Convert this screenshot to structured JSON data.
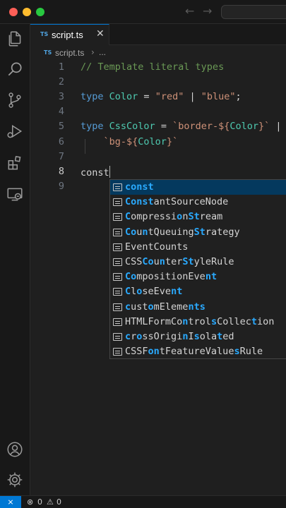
{
  "titlebar": {
    "back_icon": "arrow-left-icon",
    "forward_icon": "arrow-right-icon"
  },
  "activity_bar": {
    "top_icons": [
      "files-icon",
      "search-icon",
      "source-control-icon",
      "run-debug-icon",
      "extensions-icon",
      "remote-explorer-icon"
    ],
    "bottom_icons": [
      "account-icon",
      "settings-gear-icon"
    ]
  },
  "tab": {
    "lang_badge": "TS",
    "file_name": "script.ts",
    "close_glyph": "✕"
  },
  "breadcrumb": {
    "lang_badge": "TS",
    "file_name": "script.ts",
    "separator": "›",
    "more": "..."
  },
  "editor": {
    "lines": [
      {
        "number": "1",
        "tokens": [
          {
            "t": "// Template literal types",
            "c": "cm"
          }
        ]
      },
      {
        "number": "2",
        "tokens": []
      },
      {
        "number": "3",
        "tokens": [
          {
            "t": "type",
            "c": "kw"
          },
          {
            "t": " ",
            "c": "plain"
          },
          {
            "t": "Color",
            "c": "ty"
          },
          {
            "t": " = ",
            "c": "plain"
          },
          {
            "t": "\"red\"",
            "c": "str"
          },
          {
            "t": " | ",
            "c": "plain"
          },
          {
            "t": "\"blue\"",
            "c": "str"
          },
          {
            "t": ";",
            "c": "plain"
          }
        ]
      },
      {
        "number": "4",
        "tokens": []
      },
      {
        "number": "5",
        "tokens": [
          {
            "t": "type",
            "c": "kw"
          },
          {
            "t": " ",
            "c": "plain"
          },
          {
            "t": "CssColor",
            "c": "ty"
          },
          {
            "t": " = ",
            "c": "plain"
          },
          {
            "t": "`border-${",
            "c": "str"
          },
          {
            "t": "Color",
            "c": "ty"
          },
          {
            "t": "}`",
            "c": "str"
          },
          {
            "t": " |",
            "c": "plain"
          }
        ]
      },
      {
        "number": "6",
        "tokens": [
          {
            "t": "    ",
            "c": "plain"
          },
          {
            "t": "`bg-${",
            "c": "str"
          },
          {
            "t": "Color",
            "c": "ty"
          },
          {
            "t": "}`",
            "c": "str"
          }
        ]
      },
      {
        "number": "7",
        "tokens": []
      },
      {
        "number": "8",
        "tokens": [
          {
            "t": "const",
            "c": "plain"
          }
        ],
        "cursor": true
      },
      {
        "number": "9",
        "tokens": []
      }
    ]
  },
  "suggestions": [
    {
      "parts": [
        {
          "t": "const",
          "h": true
        }
      ],
      "selected": true
    },
    {
      "parts": [
        {
          "t": "Const",
          "h": true
        },
        {
          "t": "antSourceNode",
          "h": false
        }
      ]
    },
    {
      "parts": [
        {
          "t": "C",
          "h": true
        },
        {
          "t": "ompressi",
          "h": false
        },
        {
          "t": "o",
          "h": true
        },
        {
          "t": "n",
          "h": false
        },
        {
          "t": "St",
          "h": true
        },
        {
          "t": "ream",
          "h": false
        }
      ]
    },
    {
      "parts": [
        {
          "t": "Co",
          "h": true
        },
        {
          "t": "u",
          "h": false
        },
        {
          "t": "n",
          "h": true
        },
        {
          "t": "tQueuing",
          "h": false
        },
        {
          "t": "St",
          "h": true
        },
        {
          "t": "rategy",
          "h": false
        }
      ]
    },
    {
      "parts": [
        {
          "t": "EventCo",
          "h": false
        },
        {
          "t": "unts",
          "h": false
        }
      ]
    },
    {
      "parts": [
        {
          "t": "CSS",
          "h": false
        },
        {
          "t": "Co",
          "h": true
        },
        {
          "t": "u",
          "h": false
        },
        {
          "t": "n",
          "h": true
        },
        {
          "t": "ter",
          "h": false
        },
        {
          "t": "St",
          "h": true
        },
        {
          "t": "yleRule",
          "h": false
        }
      ]
    },
    {
      "parts": [
        {
          "t": "Co",
          "h": true
        },
        {
          "t": "mpositionEve",
          "h": false
        },
        {
          "t": "nt",
          "h": true
        }
      ]
    },
    {
      "parts": [
        {
          "t": "C",
          "h": true
        },
        {
          "t": "l",
          "h": false
        },
        {
          "t": "o",
          "h": true
        },
        {
          "t": "seEve",
          "h": false
        },
        {
          "t": "nt",
          "h": true
        }
      ]
    },
    {
      "parts": [
        {
          "t": "c",
          "h": true
        },
        {
          "t": "ust",
          "h": false
        },
        {
          "t": "o",
          "h": true
        },
        {
          "t": "mEleme",
          "h": false
        },
        {
          "t": "nts",
          "h": true
        }
      ]
    },
    {
      "parts": [
        {
          "t": "HTMLFormCo",
          "h": false
        },
        {
          "t": "n",
          "h": true
        },
        {
          "t": "trol",
          "h": false
        },
        {
          "t": "s",
          "h": true
        },
        {
          "t": "Collec",
          "h": false
        },
        {
          "t": "t",
          "h": true
        },
        {
          "t": "ion",
          "h": false
        }
      ]
    },
    {
      "parts": [
        {
          "t": "c",
          "h": true
        },
        {
          "t": "r",
          "h": false
        },
        {
          "t": "o",
          "h": true
        },
        {
          "t": "ssOrigi",
          "h": false
        },
        {
          "t": "n",
          "h": true
        },
        {
          "t": "I",
          "h": false
        },
        {
          "t": "s",
          "h": true
        },
        {
          "t": "ola",
          "h": false
        },
        {
          "t": "t",
          "h": true
        },
        {
          "t": "ed",
          "h": false
        }
      ]
    },
    {
      "parts": [
        {
          "t": "CSSF",
          "h": false
        },
        {
          "t": "on",
          "h": true
        },
        {
          "t": "tFeatureValue",
          "h": false
        },
        {
          "t": "s",
          "h": true
        },
        {
          "t": "Rule",
          "h": false
        }
      ]
    }
  ],
  "statusbar": {
    "remote_glyph": "⨯",
    "errors": "0",
    "warnings": "0"
  }
}
